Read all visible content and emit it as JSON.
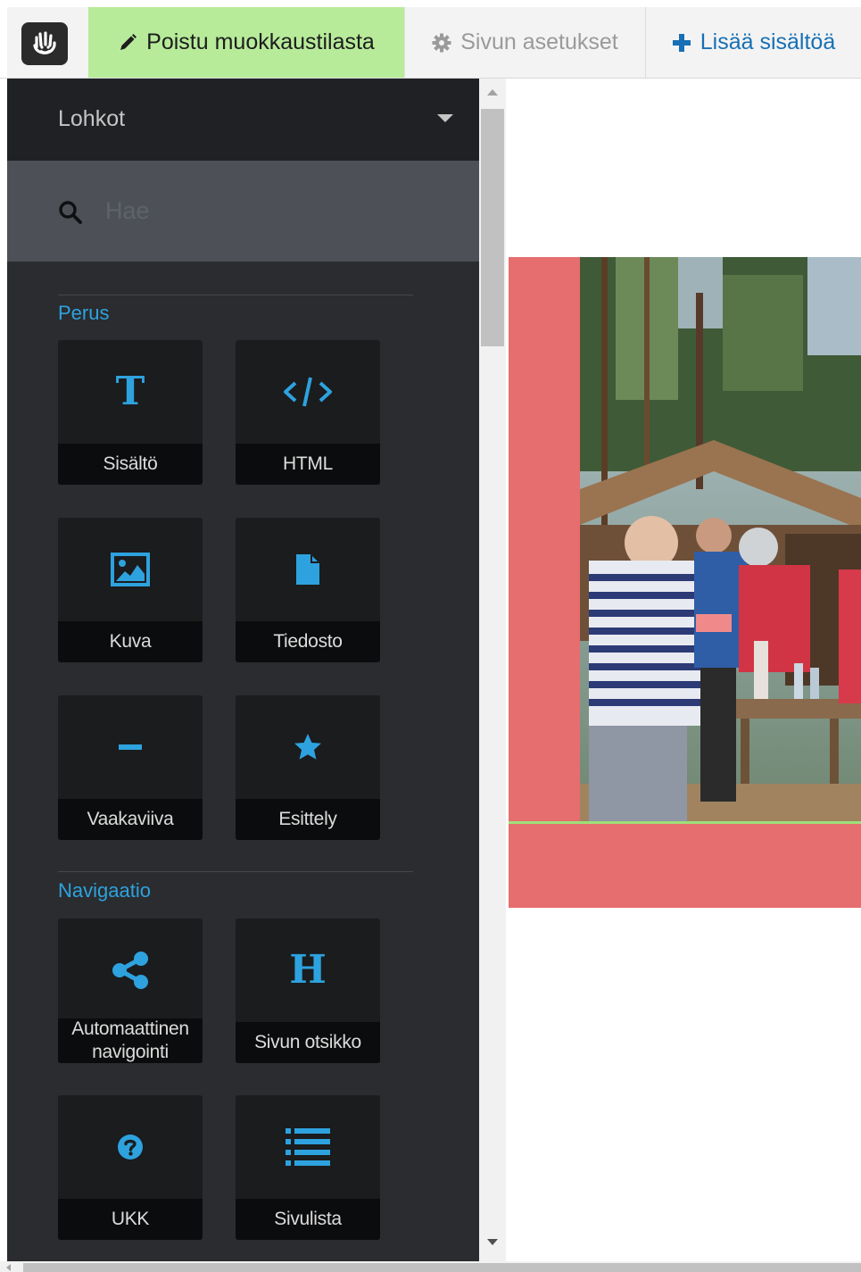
{
  "toolbar": {
    "exit_label": "Poistu muokkaustilasta",
    "settings_label": "Sivun asetukset",
    "add_label": "Lisää sisältöä"
  },
  "panel": {
    "title": "Lohkot",
    "search_placeholder": "Hae",
    "sections": [
      {
        "title": "Perus",
        "tiles": [
          {
            "label": "Sisältö",
            "icon": "text-icon"
          },
          {
            "label": "HTML",
            "icon": "code-icon"
          },
          {
            "label": "Kuva",
            "icon": "image-icon"
          },
          {
            "label": "Tiedosto",
            "icon": "file-icon"
          },
          {
            "label": "Vaakaviiva",
            "icon": "minus-icon"
          },
          {
            "label": "Esittely",
            "icon": "star-icon"
          }
        ]
      },
      {
        "title": "Navigaatio",
        "tiles": [
          {
            "label": "Automaattinen navigointi",
            "icon": "share-icon"
          },
          {
            "label": "Sivun otsikko",
            "icon": "heading-icon"
          },
          {
            "label": "UKK",
            "icon": "question-icon"
          },
          {
            "label": "Sivulista",
            "icon": "list-icon"
          }
        ]
      }
    ]
  },
  "colors": {
    "accent": "#2ea2de",
    "exit_button": "#b7eb9a",
    "panel_bg": "#2a2c2f",
    "hero": "#e66e6e"
  }
}
